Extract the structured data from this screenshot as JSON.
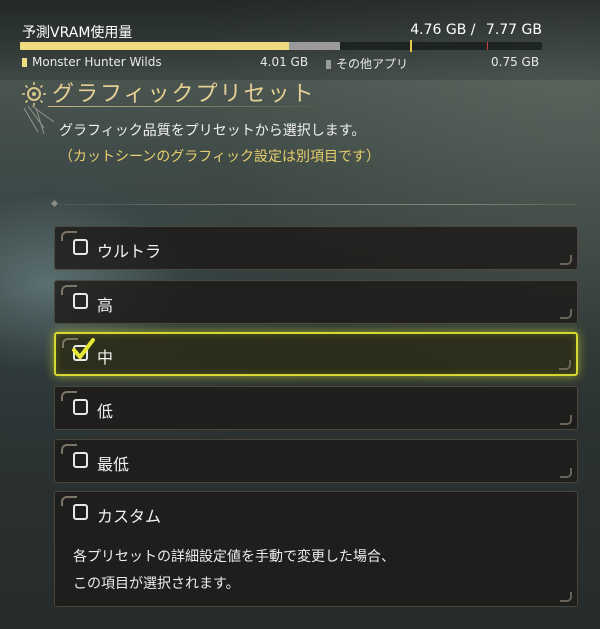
{
  "vram": {
    "title": "予測VRAM使用量",
    "used": "4.76 GB /",
    "total": "7.77 GB",
    "game_fraction": 0.516,
    "other_fraction": 0.097,
    "legend": [
      {
        "label": "Monster Hunter Wilds",
        "value": "4.01 GB",
        "color": "#f0dc80"
      },
      {
        "label": "その他アプリ",
        "value": "0.75 GB",
        "color": "#9a9a9a"
      }
    ]
  },
  "section": {
    "title": "グラフィックプリセット",
    "description": "グラフィック品質をプリセットから選択します。",
    "note": "（カットシーンのグラフィック設定は別項目です）"
  },
  "options": [
    {
      "label": "ウルトラ",
      "checked": false
    },
    {
      "label": "高",
      "checked": false
    },
    {
      "label": "中",
      "checked": true
    },
    {
      "label": "低",
      "checked": false
    },
    {
      "label": "最低",
      "checked": false
    },
    {
      "label": "カスタム",
      "checked": false,
      "description_lines": [
        "各プリセットの詳細設定値を手動で変更した場合、",
        "この項目が選択されます。"
      ]
    }
  ],
  "colors": {
    "accent": "#d4d830",
    "title": "#e6cf95",
    "note": "#e7cf6c"
  }
}
